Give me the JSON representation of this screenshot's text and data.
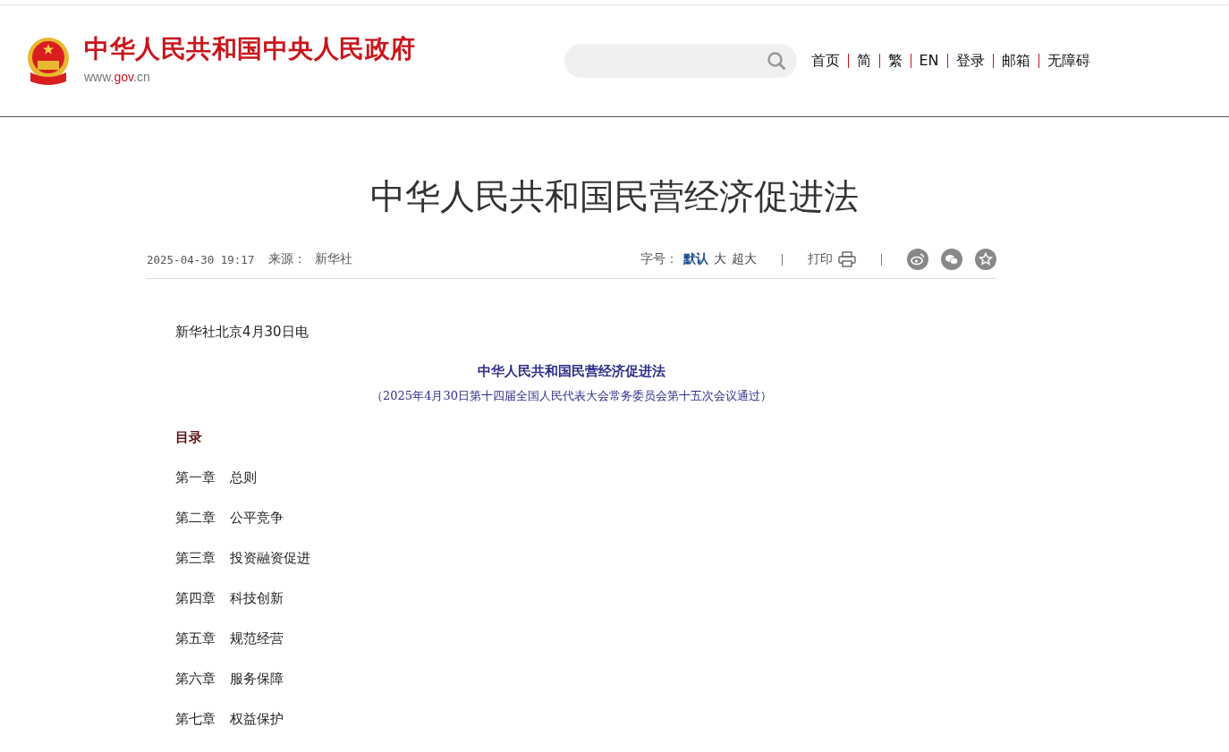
{
  "header": {
    "site_name": "中华人民共和国中央人民政府",
    "domain_prefix": "www.",
    "domain_main": "gov",
    "domain_suffix": ".cn",
    "nav": [
      "首页",
      "简",
      "繁",
      "EN",
      "登录",
      "邮箱",
      "无障碍"
    ]
  },
  "article": {
    "title": "中华人民共和国民营经济促进法",
    "date": "2025-04-30 19:17",
    "source_label": "来源：",
    "source": "新华社",
    "font_size_label": "字号：",
    "font_sizes": [
      {
        "label": "默认",
        "selected": true
      },
      {
        "label": "大",
        "selected": false
      },
      {
        "label": "超大",
        "selected": false
      }
    ],
    "print_label": "打印",
    "share": [
      {
        "kind": "weibo"
      },
      {
        "kind": "wechat"
      },
      {
        "kind": "favorite"
      }
    ],
    "dateline": "新华社北京4月30日电",
    "law_title": "中华人民共和国民营经济促进法",
    "law_note": "（2025年4月30日第十四届全国人民代表大会常务委员会第十五次会议通过）",
    "toc_heading": "目录",
    "chapters": [
      {
        "number": "第一章",
        "name": "总则"
      },
      {
        "number": "第二章",
        "name": "公平竞争"
      },
      {
        "number": "第三章",
        "name": "投资融资促进"
      },
      {
        "number": "第四章",
        "name": "科技创新"
      },
      {
        "number": "第五章",
        "name": "规范经营"
      },
      {
        "number": "第六章",
        "name": "服务保障"
      },
      {
        "number": "第七章",
        "name": "权益保护"
      }
    ]
  }
}
